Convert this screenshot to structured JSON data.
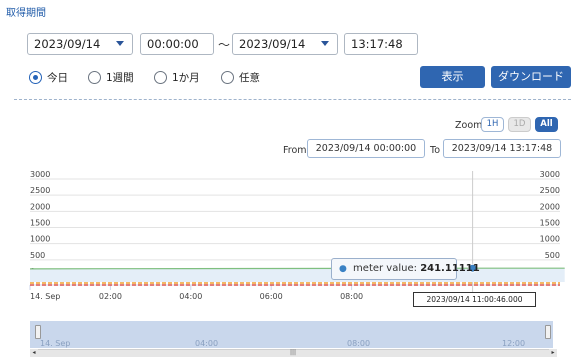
{
  "section_title": "取得期間",
  "period": {
    "start_date": "2023/09/14",
    "start_time": "00:00:00",
    "separator": "～",
    "end_date": "2023/09/14",
    "end_time": "13:17:48"
  },
  "radios": [
    {
      "label": "今日",
      "checked": true
    },
    {
      "label": "1週間",
      "checked": false
    },
    {
      "label": "1か月",
      "checked": false
    },
    {
      "label": "任意",
      "checked": false
    }
  ],
  "buttons": {
    "show": "表示",
    "download": "ダウンロード"
  },
  "zoom": {
    "label": "Zoom",
    "options": [
      "1H",
      "1D",
      "All"
    ],
    "active": "All",
    "disabled": "1D"
  },
  "range": {
    "from_label": "From",
    "from_value": "2023/09/14 00:00:00",
    "to_label": "To",
    "to_value": "2023/09/14 13:17:48"
  },
  "tooltip": {
    "series": "meter value:",
    "value": "241.11111"
  },
  "crosshair_label": "2023/09/14 11:00:46.000",
  "navigator_labels": [
    "14. Sep",
    "04:00",
    "08:00",
    "12:00"
  ],
  "colors": {
    "accent": "#2f66b1",
    "series": "#3b82c4",
    "threshold_red": "#d9534f",
    "threshold_orange": "#f0a030",
    "navigator": "#c9d7ec"
  },
  "chart_data": {
    "type": "line",
    "ylim": [
      0,
      3000
    ],
    "y_ticks": [
      "0",
      "500",
      "1000",
      "1500",
      "2000",
      "2500",
      "3000"
    ],
    "x_ticks": [
      "14. Sep",
      "02:00",
      "04:00",
      "06:00",
      "08:00"
    ],
    "series": [
      {
        "name": "meter value",
        "points": [
          [
            0,
            220
          ],
          [
            2,
            225
          ],
          [
            4,
            228
          ],
          [
            6,
            232
          ],
          [
            8,
            236
          ],
          [
            10,
            239
          ],
          [
            11.01,
            241.11111
          ],
          [
            13.3,
            240
          ]
        ]
      }
    ]
  }
}
